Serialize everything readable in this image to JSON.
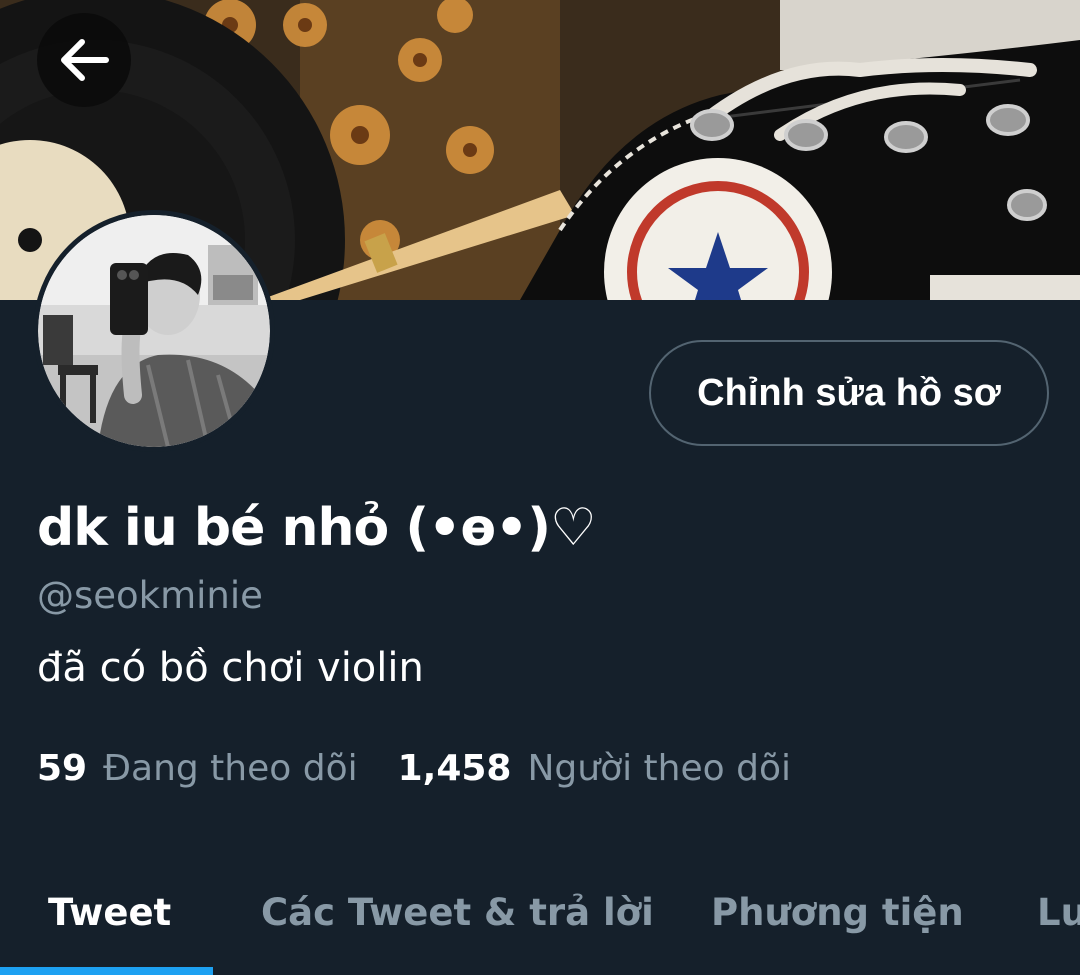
{
  "header": {
    "back_icon": "arrow-left-icon"
  },
  "profile": {
    "display_name": "dk iu bé nhỏ (•ɵ•)♡",
    "handle": "@seokminie",
    "bio": "đã có bồ chơi violin",
    "edit_label": "Chỉnh sửa hồ sơ",
    "following_count": "59",
    "following_label": "Đang theo dõi",
    "followers_count": "1,458",
    "followers_label": "Người theo dõi"
  },
  "tabs": [
    {
      "label": "Tweet",
      "active": true
    },
    {
      "label": "Các Tweet & trả lời",
      "active": false
    },
    {
      "label": "Phương tiện",
      "active": false
    },
    {
      "label": "Lu",
      "active": false
    }
  ],
  "colors": {
    "background": "#15202b",
    "accent": "#1da1f2",
    "secondary_text": "#8899a6",
    "border": "#536471"
  }
}
